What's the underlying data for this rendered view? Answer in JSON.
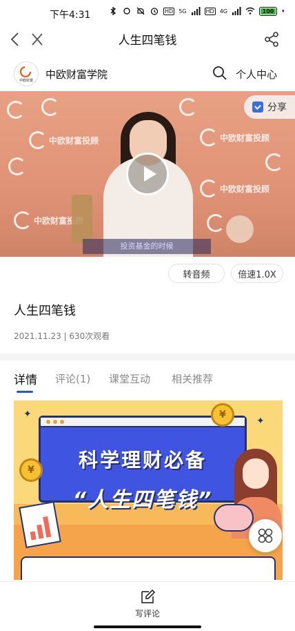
{
  "status_bar": {
    "time": "下午4:31",
    "net_5g": "5G",
    "net_4g": "4G",
    "hd1": "HD",
    "hd2": "HD",
    "battery": "100"
  },
  "titlebar": {
    "title": "人生四笔钱",
    "back_icon": "chevron-left-icon",
    "close_icon": "close-icon",
    "share_icon": "share-icon"
  },
  "brand": {
    "name": "中欧财富学院",
    "logo_text": "中欧财富",
    "search_icon": "search-icon",
    "center_label": "个人中心"
  },
  "video": {
    "watermark": "中欧财富投顾",
    "caption": "投资基金的时候",
    "share_label": "分享",
    "play_icon": "play-icon"
  },
  "controls": {
    "audio_label": "转音频",
    "speed_label": "倍速1.0X"
  },
  "course": {
    "title": "人生四笔钱",
    "meta": "2021.11.23 | 630次观看"
  },
  "tabs": [
    {
      "label": "详情",
      "active": true
    },
    {
      "label": "评论(1)",
      "active": false
    },
    {
      "label": "课堂互动",
      "active": false
    },
    {
      "label": "相关推荐",
      "active": false
    }
  ],
  "banner": {
    "line1": "科学理财必备",
    "line2": "“人生四笔钱”",
    "coin_symbol": "¥"
  },
  "bottom": {
    "write_label": "写评论",
    "write_icon": "edit-icon"
  },
  "colors": {
    "accent": "#1e5bd8",
    "banner_bg": "#fbd97a",
    "banner_screen": "#3f55e1"
  }
}
